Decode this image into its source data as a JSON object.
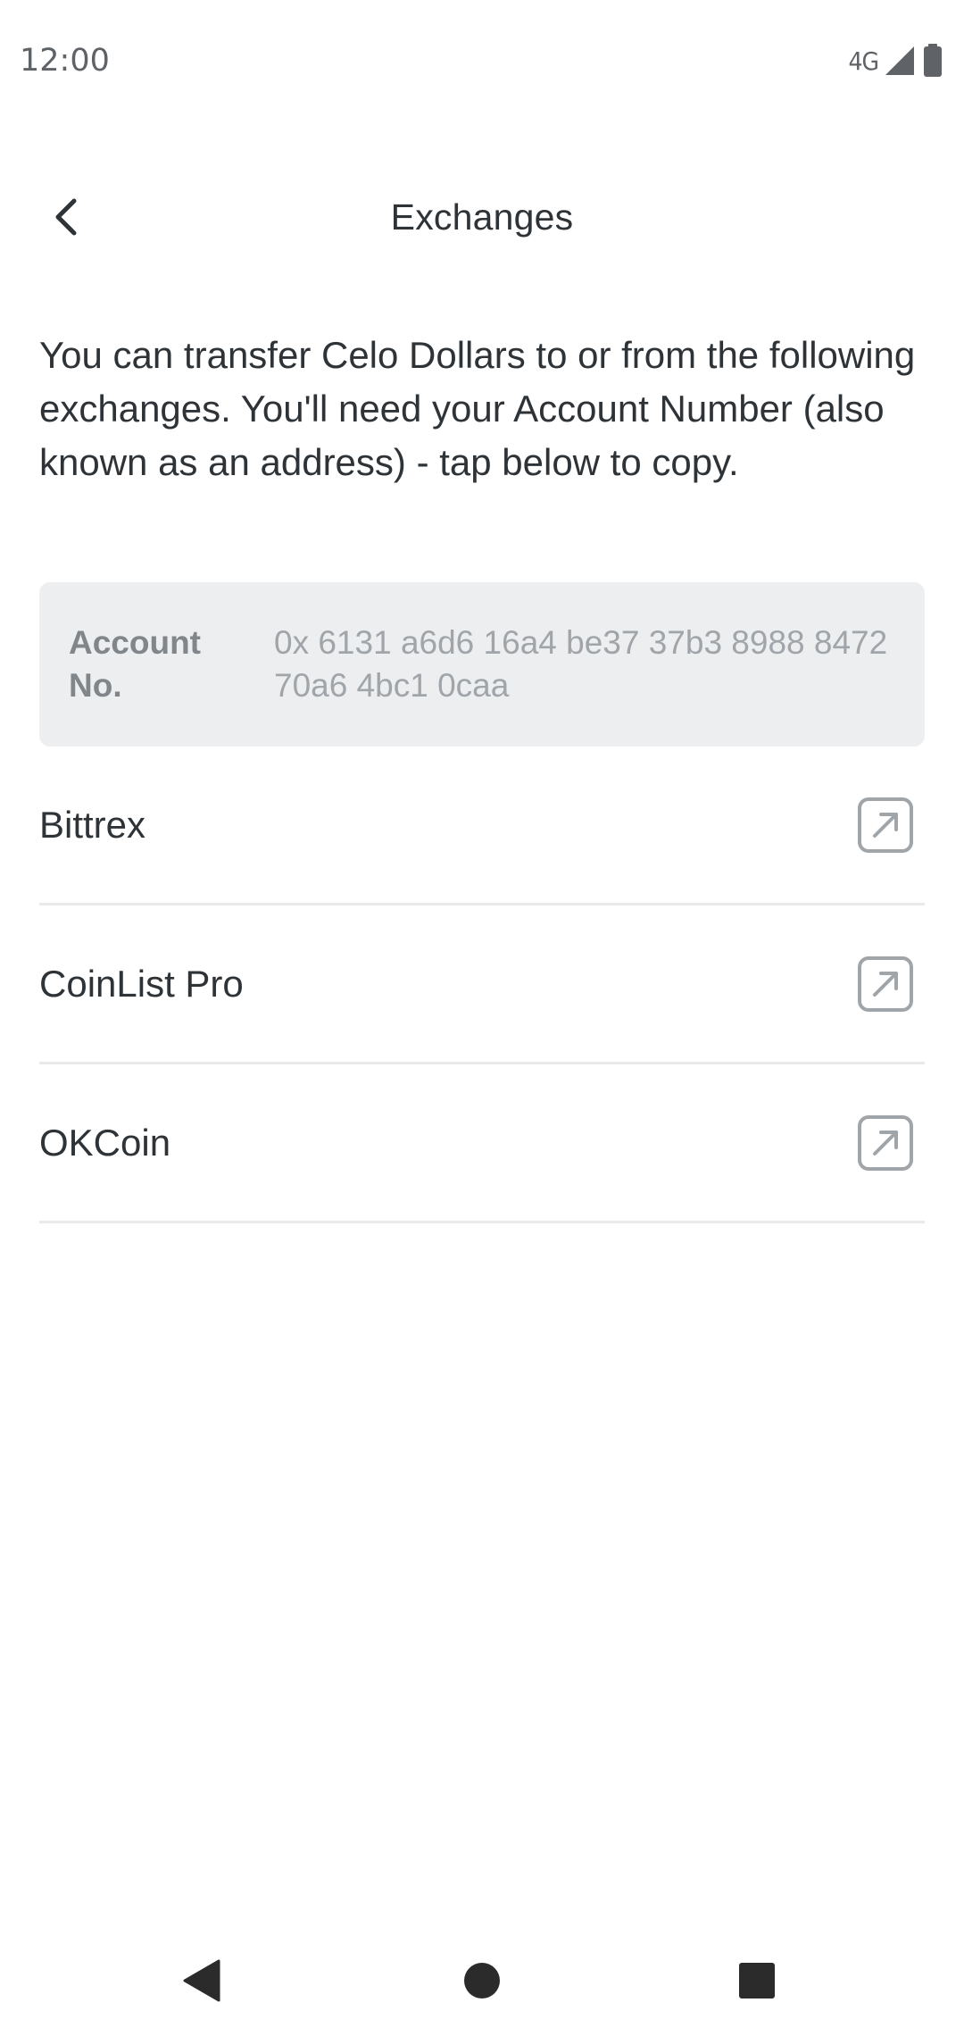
{
  "status_bar": {
    "time": "12:00",
    "network": "4G",
    "icons": [
      "signal-icon",
      "battery-icon"
    ]
  },
  "header": {
    "title": "Exchanges",
    "back_icon": "chevron-left-icon"
  },
  "intro_text": "You can transfer Celo Dollars to or from the following exchanges. You'll need your Account Number (also known as an address) - tap below to copy.",
  "account": {
    "label": "Account No.",
    "value": "0x 6131 a6d6 16a4 be37 37b3 8988 8472 70a6 4bc1 0caa"
  },
  "exchanges": [
    {
      "name": "Bittrex",
      "icon": "external-link-icon"
    },
    {
      "name": "CoinList Pro",
      "icon": "external-link-icon"
    },
    {
      "name": "OKCoin",
      "icon": "external-link-icon"
    }
  ],
  "nav_bar": {
    "icons": [
      "back-triangle-icon",
      "home-circle-icon",
      "recents-square-icon"
    ]
  },
  "colors": {
    "text_primary": "#2e3338",
    "text_muted": "#81868b",
    "account_bg": "#edeef0",
    "divider": "#e8e9ea",
    "icon_gray": "#a0a5aa"
  }
}
